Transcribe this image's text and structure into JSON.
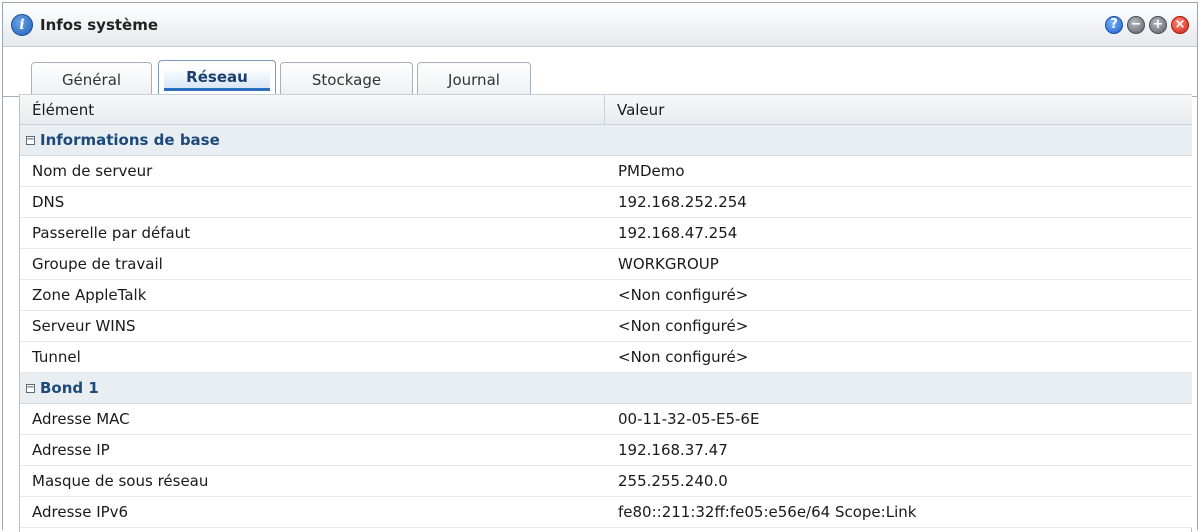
{
  "window": {
    "title": "Infos système",
    "title_icon": "info-icon",
    "controls": [
      "help-icon",
      "minimize-icon",
      "maximize-icon",
      "close-icon"
    ],
    "control_glyphs": {
      "help": "?",
      "min": "−",
      "max": "+",
      "close": "×"
    }
  },
  "tabs": [
    {
      "label": "Général",
      "active": false
    },
    {
      "label": "Réseau",
      "active": true
    },
    {
      "label": "Stockage",
      "active": false
    },
    {
      "label": "Journal",
      "active": false
    }
  ],
  "table": {
    "columns": [
      "Élément",
      "Valeur"
    ],
    "groups": [
      {
        "title": "Informations de base",
        "toggle": "⊟",
        "rows": [
          {
            "item": "Nom de serveur",
            "value": "PMDemo"
          },
          {
            "item": "DNS",
            "value": "192.168.252.254"
          },
          {
            "item": "Passerelle par défaut",
            "value": "192.168.47.254"
          },
          {
            "item": "Groupe de travail",
            "value": "WORKGROUP"
          },
          {
            "item": "Zone AppleTalk",
            "value": "<Non configuré>"
          },
          {
            "item": "Serveur WINS",
            "value": "<Non configuré>"
          },
          {
            "item": "Tunnel",
            "value": "<Non configuré>"
          }
        ]
      },
      {
        "title": "Bond 1",
        "toggle": "⊟",
        "rows": [
          {
            "item": "Adresse MAC",
            "value": "00-11-32-05-E5-6E"
          },
          {
            "item": "Adresse IP",
            "value": "192.168.37.47"
          },
          {
            "item": "Masque de sous réseau",
            "value": "255.255.240.0"
          },
          {
            "item": "Adresse IPv6",
            "value": "fe80::211:32ff:fe05:e56e/64 Scope:Link"
          }
        ]
      }
    ]
  },
  "colors": {
    "accent": "#2a6fbd",
    "group_text": "#1d4a7a",
    "close": "#d02010"
  }
}
